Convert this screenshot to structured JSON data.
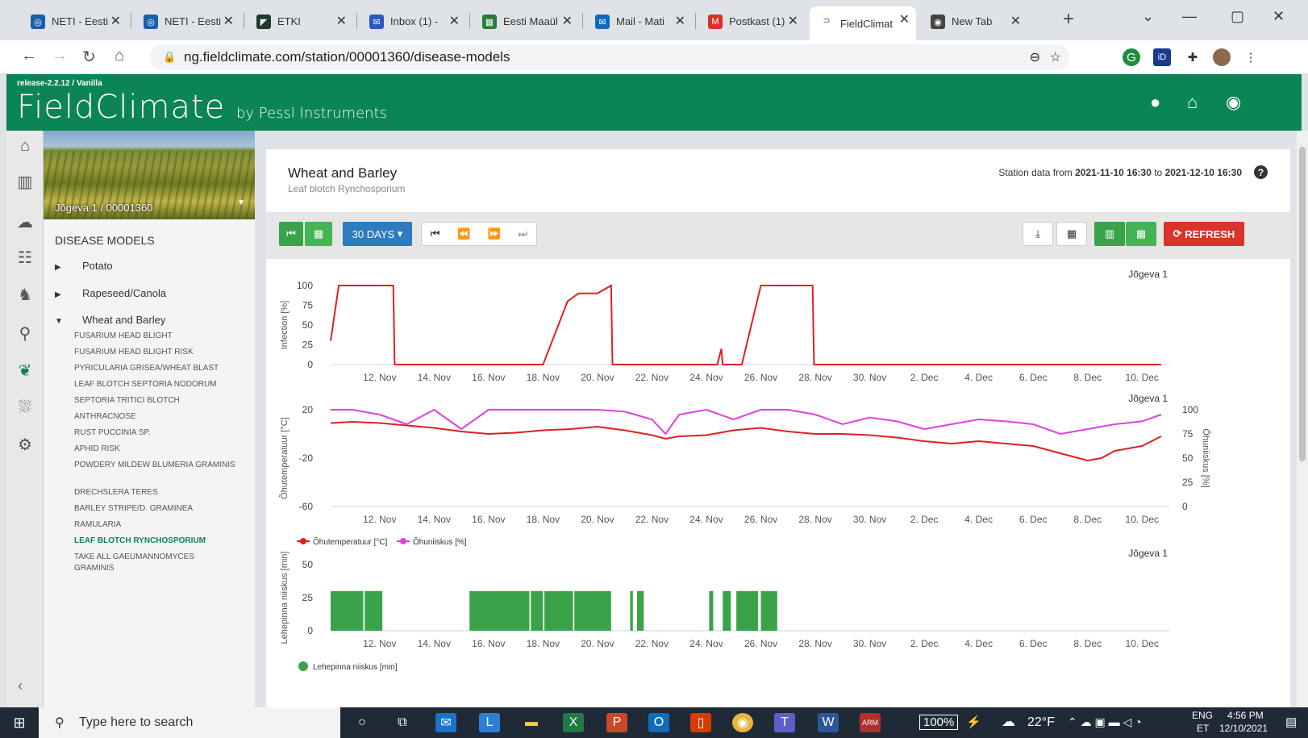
{
  "browser": {
    "tabs": [
      {
        "label": "NETI - Eesti",
        "color": "#1a5fa8",
        "glyph": "◎"
      },
      {
        "label": "NETI - Eesti",
        "color": "#1a5fa8",
        "glyph": "◎"
      },
      {
        "label": "ETKI",
        "color": "#1d3b2a",
        "glyph": "◤"
      },
      {
        "label": "Inbox (1) - ",
        "color": "#2a58c2",
        "glyph": "✉"
      },
      {
        "label": "Eesti Maaül",
        "color": "#2a7a3a",
        "glyph": "▦"
      },
      {
        "label": "Mail - Mati",
        "color": "#0f6cbd",
        "glyph": "✉"
      },
      {
        "label": "Postkast (1)",
        "color": "#d93025",
        "glyph": "M"
      },
      {
        "label": "FieldClimat",
        "color": "#ffffff",
        "glyph": "⊃"
      },
      {
        "label": "New Tab",
        "color": "#444444",
        "glyph": "◉"
      }
    ],
    "close_glyph": "✕",
    "new_tab_glyph": "+",
    "url": "ng.fieldclimate.com/station/00001360/disease-models"
  },
  "app": {
    "release": "release-2.2.12 / Vanilla",
    "logo_main": "FieldClimate",
    "logo_sub": "by Pessl Instruments"
  },
  "sidebar": {
    "station": "Jõgeva 1 / 00001360",
    "title": "DISEASE MODELS",
    "categories": [
      {
        "label": "Potato",
        "arrow": "▶"
      },
      {
        "label": "Rapeseed/Canola",
        "arrow": "▶"
      },
      {
        "label": "Wheat and Barley",
        "arrow": "▼"
      }
    ],
    "items": [
      "FUSARIUM HEAD BLIGHT",
      "FUSARIUM HEAD BLIGHT RISK",
      "PYRICULARIA GRISEA/WHEAT BLAST",
      "LEAF BLOTCH SEPTORIA NODORUM",
      "SEPTORIA TRITICI BLOTCH",
      "ANTHRACNOSE",
      "RUST PUCCINIA SP.",
      "APHID RISK",
      "POWDERY MILDEW BLUMERIA GRAMINIS",
      "DRECHSLERA TERES",
      "BARLEY STRIPE/D. GRAMINEA",
      "RAMULARIA",
      "LEAF BLOTCH RYNCHOSPORIUM",
      "TAKE ALL GAEUMANNOMYCES GRAMINIS"
    ],
    "active_item": "LEAF BLOTCH RYNCHOSPORIUM"
  },
  "page": {
    "title": "Wheat and Barley",
    "subtitle": "Leaf blotch Rynchosporium",
    "station_data_label": "Station data from",
    "date_from": "2021-11-10 16:30",
    "to_label": "to",
    "date_to": "2021-12-10 16:30",
    "help": "?"
  },
  "toolbar": {
    "period": "30 DAYS",
    "refresh": "REFRESH"
  },
  "colors": {
    "green": "#3aa34a",
    "red": "#e02020",
    "magenta": "#e040e0"
  },
  "chart_data": [
    {
      "type": "line",
      "station": "Jõgeva 1",
      "ylabel": "Infection [%]",
      "ylim": [
        0,
        100
      ],
      "yticks": [
        0,
        25,
        50,
        75,
        100
      ],
      "xticks": [
        "12. Nov",
        "14. Nov",
        "16. Nov",
        "18. Nov",
        "20. Nov",
        "22. Nov",
        "24. Nov",
        "26. Nov",
        "28. Nov",
        "30. Nov",
        "2. Dec",
        "4. Dec",
        "6. Dec",
        "8. Dec",
        "10. Dec"
      ],
      "series": [
        {
          "color": "#e02020",
          "x": [
            10.2,
            10.5,
            11.3,
            12.5,
            12.55,
            13,
            18.0,
            18.9,
            19.3,
            20.0,
            20.5,
            20.55,
            24.4,
            24.55,
            24.6,
            25.3,
            26.0,
            27.0,
            27.9,
            27.95,
            31,
            40.7
          ],
          "y": [
            30,
            100,
            100,
            100,
            0,
            0,
            0,
            80,
            90,
            90,
            100,
            0,
            0,
            20,
            0,
            0,
            100,
            100,
            100,
            0,
            0,
            0
          ]
        }
      ]
    },
    {
      "type": "line",
      "station": "Jõgeva 1",
      "ylabel": "Õhutemperatuur [°C]",
      "y2label": "Õhuniiskus [%]",
      "ylim": [
        -60,
        20
      ],
      "yticks": [
        -60,
        -20,
        20
      ],
      "y2lim": [
        0,
        100
      ],
      "y2ticks": [
        0,
        25,
        50,
        75,
        100
      ],
      "xticks": [
        "12. Nov",
        "14. Nov",
        "16. Nov",
        "18. Nov",
        "20. Nov",
        "22. Nov",
        "24. Nov",
        "26. Nov",
        "28. Nov",
        "30. Nov",
        "2. Dec",
        "4. Dec",
        "6. Dec",
        "8. Dec",
        "10. Dec"
      ],
      "legend": [
        "Õhutemperatuur [°C]",
        "Õhuniiskus [%]"
      ],
      "series": [
        {
          "name": "Õhutemperatuur [°C]",
          "color": "#e02020",
          "axis": "left",
          "x": [
            10.2,
            11,
            12,
            13,
            14,
            15,
            16,
            17,
            18,
            19,
            20,
            21,
            22,
            22.5,
            23,
            24,
            25,
            26,
            27,
            28,
            29,
            30,
            31,
            32,
            33,
            34,
            35,
            36,
            37,
            38,
            38.5,
            39,
            40,
            40.7
          ],
          "y": [
            9,
            10,
            9,
            7,
            5,
            2,
            0,
            1,
            3,
            4,
            6,
            3,
            -1,
            -4,
            -2,
            -1,
            3,
            5,
            2,
            0,
            0,
            -1,
            -3,
            -6,
            -8,
            -6,
            -8,
            -10,
            -16,
            -22,
            -20,
            -14,
            -10,
            -2
          ]
        },
        {
          "name": "Õhuniiskus [%]",
          "color": "#e040e0",
          "axis": "right",
          "x": [
            10.2,
            11,
            12,
            13,
            14,
            15,
            16,
            17,
            18,
            19,
            20,
            21,
            22,
            22.5,
            23,
            24,
            25,
            26,
            27,
            28,
            29,
            30,
            31,
            32,
            33,
            34,
            35,
            36,
            37,
            38,
            39,
            40,
            40.7
          ],
          "y": [
            100,
            100,
            95,
            85,
            100,
            80,
            100,
            100,
            100,
            100,
            100,
            98,
            90,
            75,
            95,
            100,
            90,
            100,
            100,
            95,
            85,
            92,
            88,
            80,
            85,
            90,
            88,
            85,
            75,
            80,
            85,
            88,
            95
          ]
        }
      ]
    },
    {
      "type": "bar",
      "station": "Jõgeva 1",
      "ylabel": "Lehepinna niiskus [min]",
      "ylim": [
        0,
        50
      ],
      "yticks": [
        0,
        25,
        50
      ],
      "xticks": [
        "12. Nov",
        "14. Nov",
        "16. Nov",
        "18. Nov",
        "20. Nov",
        "22. Nov",
        "24. Nov",
        "26. Nov",
        "28. Nov",
        "30. Nov",
        "2. Dec",
        "4. Dec",
        "6. Dec",
        "8. Dec",
        "10. Dec"
      ],
      "legend": [
        "Lehepinna niiskus [min]"
      ],
      "series": [
        {
          "name": "Lehepinna niiskus [min]",
          "color": "#3aa34a",
          "spans": [
            [
              10.2,
              11.4
            ],
            [
              11.45,
              12.1
            ],
            [
              15.3,
              17.5
            ],
            [
              17.55,
              18.0
            ],
            [
              18.05,
              19.1
            ],
            [
              19.15,
              20.5
            ],
            [
              21.2,
              21.3
            ],
            [
              21.45,
              21.7
            ],
            [
              24.1,
              24.25
            ],
            [
              24.6,
              24.9
            ],
            [
              25.1,
              25.9
            ],
            [
              26.0,
              26.6
            ]
          ],
          "value": 30
        }
      ]
    }
  ],
  "taskbar": {
    "search": "Type here to search",
    "battery": "100%",
    "temp": "22°F",
    "lang": "ENG",
    "region": "ET",
    "time": "4:56 PM",
    "date": "12/10/2021"
  }
}
